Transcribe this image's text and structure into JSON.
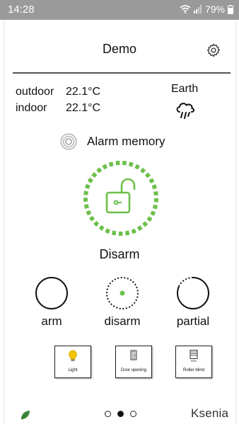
{
  "status_bar": {
    "time": "14:28",
    "battery": "79%"
  },
  "header": {
    "title": "Demo",
    "settings_icon": "gear-icon"
  },
  "temperatures": [
    {
      "label": "outdoor",
      "value": "22.1°C"
    },
    {
      "label": "indoor",
      "value": "22.1°C"
    }
  ],
  "weather": {
    "location": "Earth",
    "icon": "rain-cloud-icon"
  },
  "alarm_memory": {
    "label": "Alarm memory",
    "icon": "alarm-memory-icon"
  },
  "status": {
    "label": "Disarm",
    "icon": "open-padlock-icon",
    "color": "#6cc04a"
  },
  "modes": [
    {
      "label": "arm",
      "style": "solid"
    },
    {
      "label": "disarm",
      "style": "dotted-center"
    },
    {
      "label": "partial",
      "style": "dotted"
    }
  ],
  "tiles": [
    {
      "label": "Light",
      "icon": "lightbulb-icon",
      "icon_color": "#f2c500"
    },
    {
      "label": "Door opening",
      "icon": "door-icon"
    },
    {
      "label": "Roller blind",
      "icon": "roller-blind-icon",
      "percent": "94%"
    }
  ],
  "pager": {
    "pages": 3,
    "active": 1
  },
  "footer": {
    "brand": "Ksenia",
    "leaf_color": "#3d8b3d"
  }
}
